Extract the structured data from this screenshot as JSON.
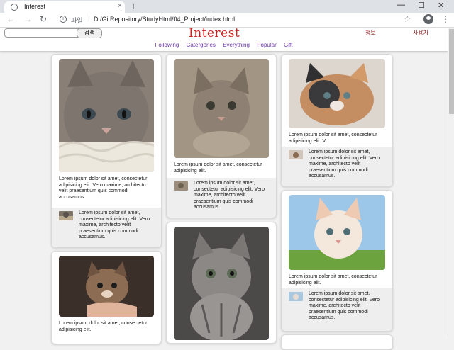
{
  "browser": {
    "tab_title": "Interest",
    "tab_close": "×",
    "new_tab": "+",
    "minimize": "—",
    "maximize": "☐",
    "close": "✕",
    "back": "←",
    "forward": "→",
    "reload": "↻",
    "scheme": "파일",
    "url": "D:/GitRepository/StudyHtml/04_Project/index.html",
    "star": "☆",
    "menu": "⋮"
  },
  "header": {
    "search_placeholder": "",
    "search_button": "검색",
    "logo": "Interest",
    "info_link": "정보",
    "user_link": "사용자"
  },
  "menu": [
    "Following",
    "Catergories",
    "Everything",
    "Popular",
    "Gift"
  ],
  "cards": [
    {
      "caption": "Lorem ipsum dolor sit amet, consectetur adipisicing elit. Vero maxime, architecto velit praesentium quis commodi accusamus.",
      "footer": "Lorem ipsum dolor sit amet, consectetur adipisicing elit. Vero maxime, architecto velit praesentium quis commodi accusamus."
    },
    {
      "caption": "Lorem ipsum dolor sit amet, consectetur adipisicing elit.",
      "footer": ""
    },
    {
      "caption": "Lorem ipsum dolor sit amet, consectetur adipisicing elit.",
      "footer": "Lorem ipsum dolor sit amet, consectetur adipisicing elit. Vero maxime, architecto velit praesentium quis commodi accusamus."
    },
    {
      "caption": "",
      "footer": ""
    },
    {
      "caption": "Lorem ipsum dolor sit amet, consectetur adipisicing elit. V",
      "footer": "Lorem ipsum dolor sit amet, consectetur adipisicing elit. Vero maxime, architecto velit praesentium quis commodi accusamus."
    },
    {
      "caption": "Lorem ipsum dolor sit amet, consectetur adipisicing elit.",
      "footer": "Lorem ipsum dolor sit amet, consectetur adipisicing elit. Vero maxime, architecto velit praesentium quis commodi accusamus."
    }
  ]
}
